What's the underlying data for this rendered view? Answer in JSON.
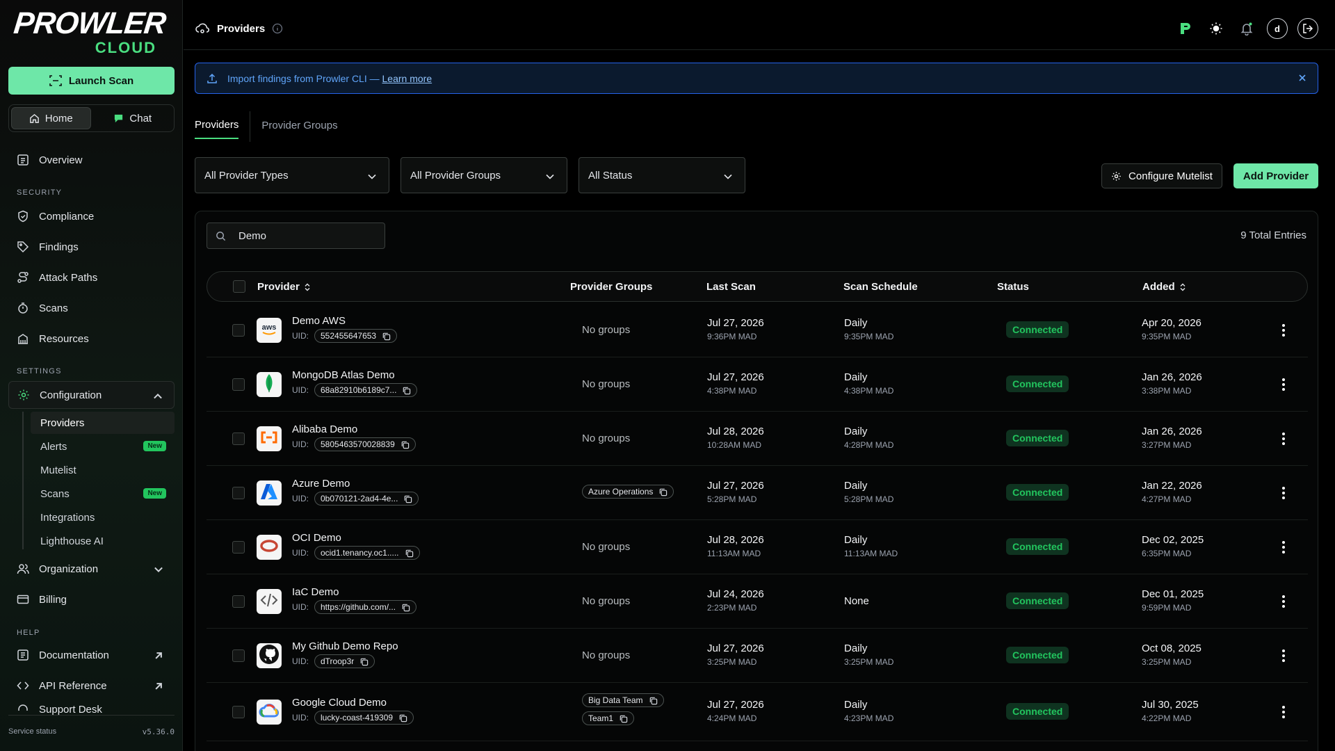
{
  "sidebar": {
    "logo_word": "PROWLER",
    "logo_sub": "CLOUD",
    "launch_scan": "Launch Scan",
    "home": "Home",
    "chat": "Chat",
    "overview": "Overview",
    "section_security": "SECURITY",
    "compliance": "Compliance",
    "findings": "Findings",
    "attack_paths": "Attack Paths",
    "scans": "Scans",
    "resources": "Resources",
    "section_settings": "SETTINGS",
    "configuration": "Configuration",
    "sub": [
      {
        "label": "Providers",
        "new": false
      },
      {
        "label": "Alerts",
        "new": true
      },
      {
        "label": "Mutelist",
        "new": false
      },
      {
        "label": "Scans",
        "new": true
      },
      {
        "label": "Integrations",
        "new": false
      },
      {
        "label": "Lighthouse AI",
        "new": false
      }
    ],
    "new_badge": "New",
    "organization": "Organization",
    "billing": "Billing",
    "section_help": "HELP",
    "documentation": "Documentation",
    "api_reference": "API Reference",
    "support_partial": "Support Desk",
    "service_status": "Service status",
    "version": "v5.36.0"
  },
  "header": {
    "title": "Providers",
    "avatar_letter": "d"
  },
  "banner": {
    "text": "Import findings from Prowler CLI — ",
    "link": "Learn more"
  },
  "tabs": [
    "Providers",
    "Provider Groups"
  ],
  "filters": {
    "provider_types": "All Provider Types",
    "provider_groups": "All Provider Groups",
    "status": "All Status"
  },
  "actions": {
    "configure_mutelist": "Configure Mutelist",
    "add_provider": "Add Provider"
  },
  "search": {
    "value": "Demo"
  },
  "total_entries": "9 Total Entries",
  "columns": {
    "provider": "Provider",
    "groups": "Provider Groups",
    "last_scan": "Last Scan",
    "schedule": "Scan Schedule",
    "status": "Status",
    "added": "Added"
  },
  "uid_label": "UID:",
  "rows": [
    {
      "name": "Demo AWS",
      "icon": "aws-icon",
      "uid": "552455647653",
      "groups": [],
      "no_groups": "No groups",
      "last_date": "Jul 27, 2026",
      "last_time": "9:36PM MAD",
      "sched": "Daily",
      "sched_time": "9:35PM MAD",
      "status": "Connected",
      "added_date": "Apr 20, 2026",
      "added_time": "9:35PM MAD"
    },
    {
      "name": "MongoDB Atlas Demo",
      "icon": "mongodb-icon",
      "uid": "68a82910b6189c7...",
      "groups": [],
      "no_groups": "No groups",
      "last_date": "Jul 27, 2026",
      "last_time": "4:38PM MAD",
      "sched": "Daily",
      "sched_time": "4:38PM MAD",
      "status": "Connected",
      "added_date": "Jan 26, 2026",
      "added_time": "3:38PM MAD"
    },
    {
      "name": "Alibaba Demo",
      "icon": "alibaba-icon",
      "uid": "5805463570028839",
      "groups": [],
      "no_groups": "No groups",
      "last_date": "Jul 28, 2026",
      "last_time": "10:28AM MAD",
      "sched": "Daily",
      "sched_time": "4:28PM MAD",
      "status": "Connected",
      "added_date": "Jan 26, 2026",
      "added_time": "3:27PM MAD"
    },
    {
      "name": "Azure Demo",
      "icon": "azure-icon",
      "uid": "0b070121-2ad4-4e...",
      "groups": [
        "Azure Operations"
      ],
      "no_groups": "",
      "last_date": "Jul 27, 2026",
      "last_time": "5:28PM MAD",
      "sched": "Daily",
      "sched_time": "5:28PM MAD",
      "status": "Connected",
      "added_date": "Jan 22, 2026",
      "added_time": "4:27PM MAD"
    },
    {
      "name": "OCI Demo",
      "icon": "oci-icon",
      "uid": "ocid1.tenancy.oc1.....",
      "groups": [],
      "no_groups": "No groups",
      "last_date": "Jul 28, 2026",
      "last_time": "11:13AM MAD",
      "sched": "Daily",
      "sched_time": "11:13AM MAD",
      "status": "Connected",
      "added_date": "Dec 02, 2025",
      "added_time": "6:35PM MAD"
    },
    {
      "name": "IaC Demo",
      "icon": "iac-code-icon",
      "uid": "https://github.com/...",
      "groups": [],
      "no_groups": "No groups",
      "last_date": "Jul 24, 2026",
      "last_time": "2:23PM MAD",
      "sched": "None",
      "sched_time": "",
      "status": "Connected",
      "added_date": "Dec 01, 2025",
      "added_time": "9:59PM MAD"
    },
    {
      "name": "My Github Demo Repo",
      "icon": "github-icon",
      "uid": "dTroop3r",
      "groups": [],
      "no_groups": "No groups",
      "last_date": "Jul 27, 2026",
      "last_time": "3:25PM MAD",
      "sched": "Daily",
      "sched_time": "3:25PM MAD",
      "status": "Connected",
      "added_date": "Oct 08, 2025",
      "added_time": "3:25PM MAD"
    },
    {
      "name": "Google Cloud Demo",
      "icon": "gcp-icon",
      "uid": "lucky-coast-419309",
      "groups": [
        "Big Data Team",
        "Team1"
      ],
      "no_groups": "",
      "last_date": "Jul 27, 2026",
      "last_time": "4:24PM MAD",
      "sched": "Daily",
      "sched_time": "4:23PM MAD",
      "status": "Connected",
      "added_date": "Jul 30, 2025",
      "added_time": "4:22PM MAD"
    }
  ],
  "colors": {
    "accent": "#6ee7a8",
    "status_green": "#22c55e",
    "banner_blue": "#2563eb"
  }
}
